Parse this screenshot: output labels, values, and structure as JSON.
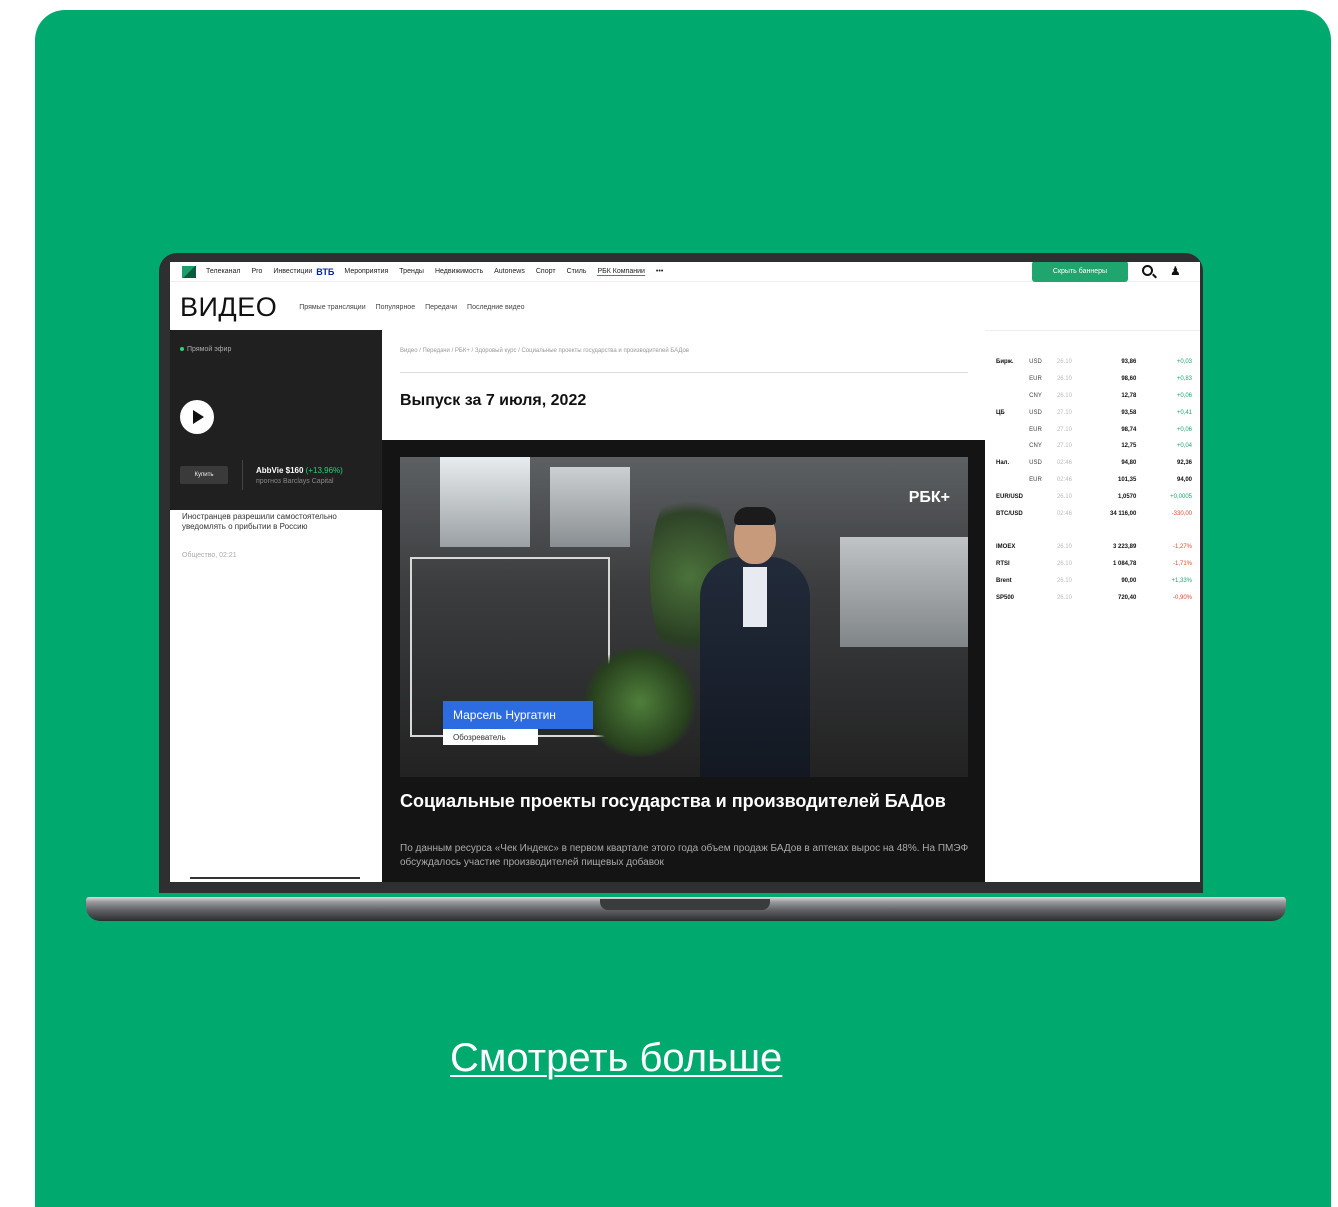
{
  "top_nav": {
    "items": [
      "Телеканал",
      "Pro",
      "Инвестиции"
    ],
    "vtb_label": "ВТБ",
    "items_after": [
      "Мероприятия",
      "Тренды",
      "Недвижимость",
      "Autonews",
      "Спорт",
      "Стиль",
      "РБК Компании",
      "•••"
    ],
    "hide_banners_label": "Скрыть баннеры"
  },
  "section": {
    "title": "ВИДЕО",
    "tabs": [
      "Прямые трансляции",
      "Популярное",
      "Передачи",
      "Последние видео"
    ]
  },
  "left": {
    "live_label": "Прямой эфир",
    "buy_label": "Купить",
    "ticker_name": "AbbVie $160",
    "ticker_change": "(+13,96%)",
    "ticker_sub": "прогноз Barclays Capital",
    "news_title": "Иностранцев разрешили самостоятельно уведомлять о прибытии в Россию",
    "news_meta": "Общество, 02:21"
  },
  "main": {
    "breadcrumb": "Видео / Передачи / РБК+ / Здоровый курс / Социальные проекты государства и производителей БАДов",
    "issue_title": "Выпуск за 7 июля, 2022",
    "channel_logo": "РБК+",
    "presenter_name": "Марсель Нургатин",
    "presenter_role": "Обозреватель",
    "article_title": "Социальные проекты государства и производителей БАДов",
    "article_lead": "По данным ресурса «Чек Индекс» в первом квартале этого года объем продаж БАДов в аптеках вырос на 48%. На ПМЭФ обсуждалось участие производителей пищевых добавок"
  },
  "rates": [
    {
      "group": "Бирж.",
      "cur": "USD",
      "date": "26.10",
      "value": "93,86",
      "change": "+0,03",
      "trend": "up"
    },
    {
      "group": "",
      "cur": "EUR",
      "date": "26.10",
      "value": "98,60",
      "change": "+0,83",
      "trend": "up"
    },
    {
      "group": "",
      "cur": "CNY",
      "date": "26.10",
      "value": "12,78",
      "change": "+0,06",
      "trend": "up"
    },
    {
      "group": "ЦБ",
      "cur": "USD",
      "date": "27.10",
      "value": "93,58",
      "change": "+0,41",
      "trend": "up"
    },
    {
      "group": "",
      "cur": "EUR",
      "date": "27.10",
      "value": "98,74",
      "change": "+0,06",
      "trend": "up"
    },
    {
      "group": "",
      "cur": "CNY",
      "date": "27.10",
      "value": "12,75",
      "change": "+0,04",
      "trend": "up"
    },
    {
      "group": "Нал.",
      "cur": "USD",
      "date": "02:46",
      "value": "94,80",
      "change": "92,36",
      "trend": "neutral"
    },
    {
      "group": "",
      "cur": "EUR",
      "date": "02:46",
      "value": "101,35",
      "change": "94,00",
      "trend": "neutral"
    },
    {
      "group": "EUR/USD",
      "cur": "",
      "date": "26.10",
      "value": "1,0570",
      "change": "+0,0005",
      "trend": "up"
    },
    {
      "group": "BTC/USD",
      "cur": "",
      "date": "02:46",
      "value": "34 116,00",
      "change": "-330,00",
      "trend": "down"
    },
    {
      "group": "",
      "cur": "",
      "date": "",
      "value": "",
      "change": "",
      "trend": "neutral"
    },
    {
      "group": "IMOEX",
      "cur": "",
      "date": "26.10",
      "value": "3 223,89",
      "change": "-1,27%",
      "trend": "down"
    },
    {
      "group": "RTSI",
      "cur": "",
      "date": "26.10",
      "value": "1 084,78",
      "change": "-1,71%",
      "trend": "down"
    },
    {
      "group": "Brent",
      "cur": "",
      "date": "26.10",
      "value": "90,00",
      "change": "+1,33%",
      "trend": "up"
    },
    {
      "group": "SP500",
      "cur": "",
      "date": "26.10",
      "value": "720,40",
      "change": "-0,90%",
      "trend": "down"
    }
  ],
  "cta_label": "Смотреть больше",
  "colors": {
    "card_bg": "#00aa6e",
    "accent_green": "#1fa56d",
    "presenter_blue": "#2d6be0"
  }
}
